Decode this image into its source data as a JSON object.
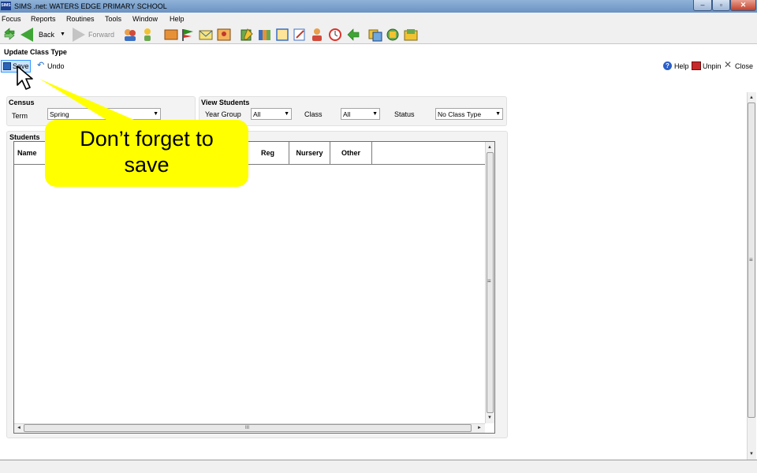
{
  "window": {
    "logo_text": "SIMS",
    "title": "SIMS .net: WATERS EDGE PRIMARY SCHOOL",
    "min_glyph": "–",
    "max_glyph": "▫",
    "close_glyph": "✕"
  },
  "menu": {
    "items": [
      {
        "label": "Focus"
      },
      {
        "label": "Reports"
      },
      {
        "label": "Routines"
      },
      {
        "label": "Tools"
      },
      {
        "label": "Window"
      },
      {
        "label": "Help"
      }
    ]
  },
  "toolbar": {
    "back_label": "Back",
    "back_dropdown_glyph": "▼",
    "forward_label": "Forward",
    "icons": [
      "people-icon",
      "person-icon",
      "book-icon",
      "flag-icon",
      "envelope-icon",
      "user-card-icon",
      "pencil-icon",
      "books-icon",
      "notebook-icon",
      "notes-icon",
      "students-icon",
      "clock-icon",
      "arrows-icon",
      "copy-icon",
      "refresh-icon",
      "folder-icon"
    ]
  },
  "panel": {
    "title": "Update Class Type",
    "save_label": "Save",
    "undo_glyph": "↶",
    "undo_label": "Undo",
    "help_glyph": "?",
    "help_label": "Help",
    "unpin_label": "Unpin",
    "close_glyph": "✕",
    "close_label": "Close"
  },
  "census": {
    "title": "Census",
    "term_label": "Term",
    "term_value": "Spring"
  },
  "view_students": {
    "title": "View Students",
    "year_group_label": "Year Group",
    "year_group_value": "All",
    "class_label": "Class",
    "class_value": "All",
    "status_label": "Status",
    "status_value": "No Class Type"
  },
  "students": {
    "title": "Students",
    "columns": [
      "Name",
      "Reg",
      "Nursery",
      "Other"
    ],
    "rows": []
  },
  "dropdown_glyph": "▼",
  "scroll": {
    "up": "▲",
    "down": "▼",
    "left": "◄",
    "right": "►",
    "grip_v": "≡",
    "grip_h": "III"
  },
  "callout": {
    "line1": "Don’t forget to",
    "line2": "save",
    "color": "#ffff00"
  },
  "colors": {
    "accent": "#3399ff",
    "title_bar": "#6b93c3"
  }
}
